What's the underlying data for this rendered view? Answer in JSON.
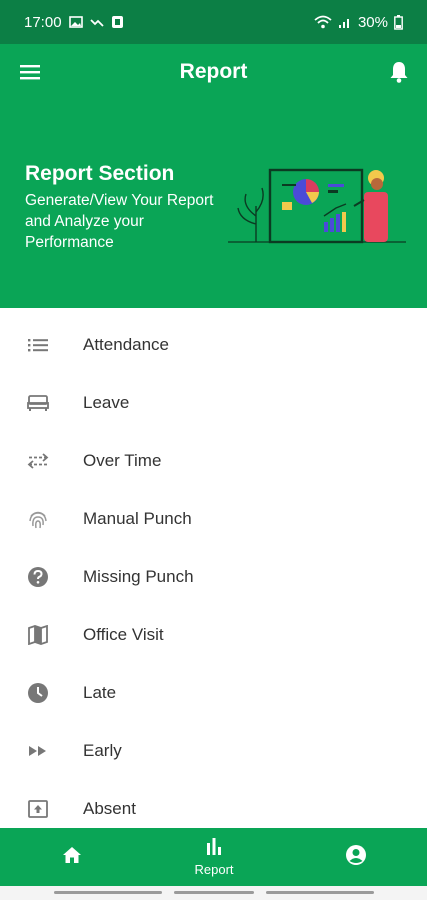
{
  "status_bar": {
    "time": "17:00",
    "battery": "30%"
  },
  "app_bar": {
    "title": "Report",
    "menu_icon": "menu-icon",
    "bell_icon": "bell-icon"
  },
  "hero": {
    "title": "Report Section",
    "subtitle": "Generate/View Your Report and Analyze your Performance"
  },
  "report_items": [
    {
      "label": "Attendance",
      "icon": "list-icon"
    },
    {
      "label": "Leave",
      "icon": "bed-icon"
    },
    {
      "label": "Over Time",
      "icon": "swap-arrows-icon"
    },
    {
      "label": "Manual Punch",
      "icon": "fingerprint-icon"
    },
    {
      "label": "Missing Punch",
      "icon": "help-circle-icon"
    },
    {
      "label": "Office Visit",
      "icon": "map-icon"
    },
    {
      "label": "Late",
      "icon": "clock-icon"
    },
    {
      "label": "Early",
      "icon": "fast-forward-icon"
    },
    {
      "label": "Absent",
      "icon": "absent-box-icon"
    }
  ],
  "bottom_nav": {
    "home_icon": "home-icon",
    "report_label": "Report",
    "profile_icon": "account-circle-icon"
  },
  "colors": {
    "primary": "#0aa556",
    "status_bar": "#0c7f45",
    "icon_gray": "#777777",
    "text": "#333333"
  }
}
